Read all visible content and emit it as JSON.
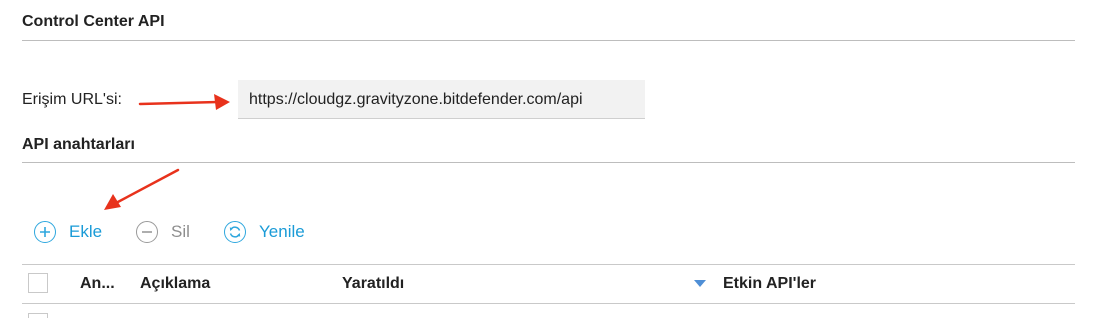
{
  "section": {
    "title": "Control Center API"
  },
  "access_url": {
    "label": "Erişim URL'si:",
    "value": "https://cloudgz.gravityzone.bitdefender.com/api"
  },
  "api_keys": {
    "title": "API anahtarları",
    "toolbar": {
      "add_label": "Ekle",
      "delete_label": "Sil",
      "refresh_label": "Yenile"
    },
    "table": {
      "columns": [
        "An...",
        "Açıklama",
        "Yaratıldı",
        "Etkin API'ler"
      ],
      "sort_column": "Yaratıldı",
      "sort_direction": "descending"
    }
  },
  "colors": {
    "accent": "#1a9bd7",
    "annotation_arrow": "#e8321c",
    "disabled": "#9a9a9a"
  },
  "icons": {
    "add": "plus-circle-icon",
    "delete": "minus-circle-icon",
    "refresh": "refresh-circle-icon",
    "sort": "sort-desc-icon"
  }
}
